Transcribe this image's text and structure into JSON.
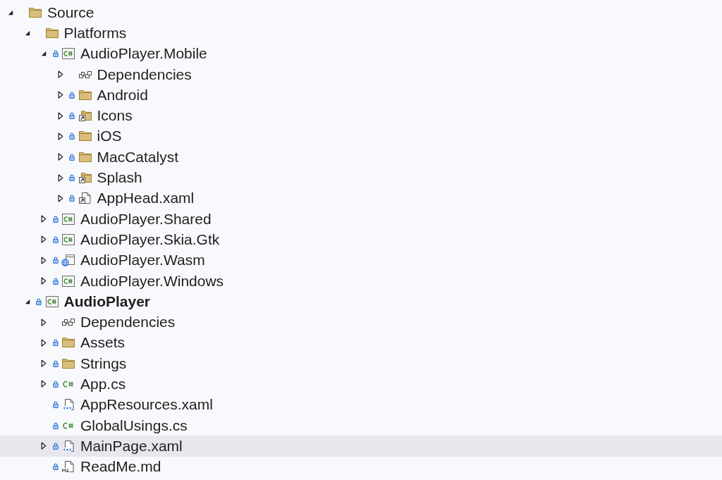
{
  "tree": [
    {
      "label": "Source",
      "kind": "folder",
      "locked": false,
      "expandable": true,
      "expanded": true,
      "selected": false,
      "startup_project": false,
      "children": [
        {
          "label": "Platforms",
          "kind": "folder",
          "locked": false,
          "expandable": true,
          "expanded": true,
          "selected": false,
          "startup_project": false,
          "children": [
            {
              "label": "AudioPlayer.Mobile",
              "kind": "csproj",
              "locked": true,
              "expandable": true,
              "expanded": true,
              "selected": false,
              "startup_project": false,
              "children": [
                {
                  "label": "Dependencies",
                  "kind": "dependencies",
                  "locked": false,
                  "expandable": true,
                  "expanded": false,
                  "selected": false,
                  "startup_project": false
                },
                {
                  "label": "Android",
                  "kind": "folder",
                  "locked": true,
                  "expandable": true,
                  "expanded": false,
                  "selected": false,
                  "startup_project": false
                },
                {
                  "label": "Icons",
                  "kind": "linked-folder",
                  "locked": true,
                  "expandable": true,
                  "expanded": false,
                  "selected": false,
                  "startup_project": false
                },
                {
                  "label": "iOS",
                  "kind": "folder",
                  "locked": true,
                  "expandable": true,
                  "expanded": false,
                  "selected": false,
                  "startup_project": false
                },
                {
                  "label": "MacCatalyst",
                  "kind": "folder",
                  "locked": true,
                  "expandable": true,
                  "expanded": false,
                  "selected": false,
                  "startup_project": false
                },
                {
                  "label": "Splash",
                  "kind": "linked-folder",
                  "locked": true,
                  "expandable": true,
                  "expanded": false,
                  "selected": false,
                  "startup_project": false
                },
                {
                  "label": "AppHead.xaml",
                  "kind": "linked-file",
                  "locked": true,
                  "expandable": true,
                  "expanded": false,
                  "selected": false,
                  "startup_project": false
                }
              ]
            },
            {
              "label": "AudioPlayer.Shared",
              "kind": "csproj",
              "locked": true,
              "expandable": true,
              "expanded": false,
              "selected": false,
              "startup_project": false
            },
            {
              "label": "AudioPlayer.Skia.Gtk",
              "kind": "csproj",
              "locked": true,
              "expandable": true,
              "expanded": false,
              "selected": false,
              "startup_project": false
            },
            {
              "label": "AudioPlayer.Wasm",
              "kind": "web-project",
              "locked": true,
              "expandable": true,
              "expanded": false,
              "selected": false,
              "startup_project": false
            },
            {
              "label": "AudioPlayer.Windows",
              "kind": "csproj",
              "locked": true,
              "expandable": true,
              "expanded": false,
              "selected": false,
              "startup_project": false
            }
          ]
        },
        {
          "label": "AudioPlayer",
          "kind": "csproj",
          "locked": true,
          "expandable": true,
          "expanded": true,
          "selected": false,
          "startup_project": true,
          "children": [
            {
              "label": "Dependencies",
              "kind": "dependencies",
              "locked": false,
              "expandable": true,
              "expanded": false,
              "selected": false,
              "startup_project": false
            },
            {
              "label": "Assets",
              "kind": "folder",
              "locked": true,
              "expandable": true,
              "expanded": false,
              "selected": false,
              "startup_project": false
            },
            {
              "label": "Strings",
              "kind": "folder",
              "locked": true,
              "expandable": true,
              "expanded": false,
              "selected": false,
              "startup_project": false
            },
            {
              "label": "App.cs",
              "kind": "csharp-file",
              "locked": true,
              "expandable": true,
              "expanded": false,
              "selected": false,
              "startup_project": false
            },
            {
              "label": "AppResources.xaml",
              "kind": "xaml-file",
              "locked": true,
              "expandable": false,
              "selected": false,
              "startup_project": false
            },
            {
              "label": "GlobalUsings.cs",
              "kind": "csharp-file",
              "locked": true,
              "expandable": false,
              "selected": false,
              "startup_project": false
            },
            {
              "label": "MainPage.xaml",
              "kind": "xaml-file",
              "locked": true,
              "expandable": true,
              "expanded": false,
              "selected": true,
              "startup_project": false
            },
            {
              "label": "ReadMe.md",
              "kind": "markdown-file",
              "locked": true,
              "expandable": false,
              "selected": false,
              "startup_project": false
            }
          ]
        }
      ]
    }
  ]
}
